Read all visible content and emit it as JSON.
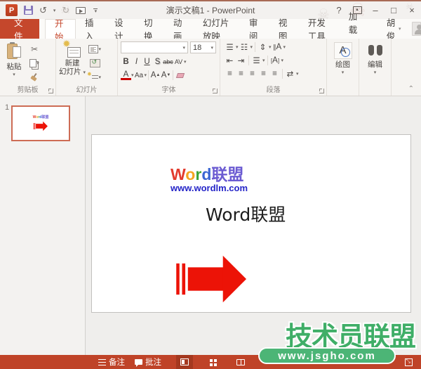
{
  "app": {
    "title": "演示文稿1 - PowerPoint",
    "accent_color": "#c5472c",
    "statusbar_color": "#bf4328"
  },
  "titlebar": {
    "logo": "P",
    "help": "?",
    "minimize": "–",
    "maximize": "□",
    "close": "×",
    "undo": "↺",
    "redo": "↻"
  },
  "tabs": {
    "file": "文件",
    "active": "开始",
    "items": [
      "开始",
      "插入",
      "设计",
      "切换",
      "动画",
      "幻灯片放映",
      "审阅",
      "视图",
      "开发工具",
      "加载项"
    ],
    "user": "胡俊"
  },
  "ribbon": {
    "clipboard": {
      "paste": "粘贴",
      "label": "剪贴板",
      "scissors": "✂"
    },
    "slides": {
      "new_slide_line1": "新建",
      "new_slide_line2": "幻灯片",
      "label": "幻灯片"
    },
    "font": {
      "size": "18",
      "bold": "B",
      "italic": "I",
      "underline": "U",
      "shadow": "S",
      "strike": "abc",
      "spacing": "AV",
      "color": "A",
      "case": "Aa",
      "grow": "A",
      "shrink": "A",
      "label": "字体"
    },
    "paragraph": {
      "label": "段落",
      "bullets": "☰",
      "numbering": "☷",
      "indent_dec": "⇤",
      "indent_inc": "⇥",
      "linespacing": "⇕",
      "direction": "A",
      "columns": "☰",
      "align_text": "A",
      "align1": "≡",
      "align2": "≡",
      "align3": "≡",
      "align4": "≡",
      "align5": "≡",
      "smartart": "⇄"
    },
    "drawing": {
      "label": "绘图",
      "icon_letter": "A"
    },
    "editing": {
      "label": "编辑"
    },
    "collapse": "⌃"
  },
  "panel": {
    "slide_number": "1"
  },
  "slide": {
    "logo": {
      "letters": [
        [
          "W",
          "#e23b2e"
        ],
        [
          "o",
          "#f5a623"
        ],
        [
          "r",
          "#3fa53a"
        ],
        [
          "d",
          "#3a66d3"
        ],
        [
          "联盟",
          "#6b5bd2"
        ]
      ],
      "url": "www.wordlm.com",
      "url_color": "#2525c8"
    },
    "title_text": "Word联盟",
    "arrow_color": "#ec1307"
  },
  "watermark": {
    "brand": "技术员联盟",
    "site": "www.jsgho.com",
    "color": "#3fae67",
    "pill_color": "#4cb576"
  },
  "statusbar": {
    "notes": "备注",
    "comments": "批注"
  },
  "decor": {
    "skull": "☠"
  }
}
